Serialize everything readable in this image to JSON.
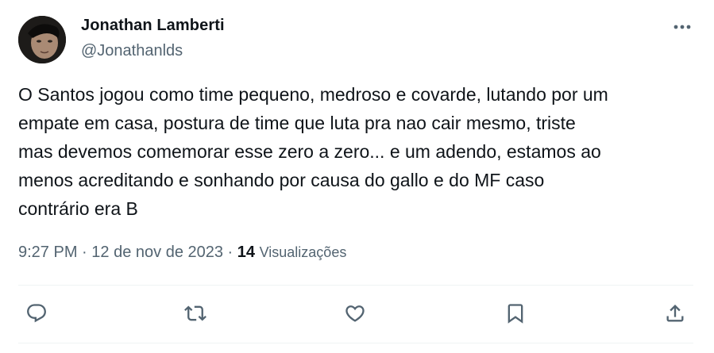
{
  "author": {
    "name": "Jonathan Lamberti",
    "handle": "@Jonathanlds"
  },
  "tweet": {
    "lines": [
      "O Santos jogou como time pequeno, medroso e covarde, lutando por um",
      "empate em casa, postura de time que luta pra nao cair mesmo, triste",
      "mas devemos comemorar esse zero a zero... e um adendo, estamos ao",
      "menos acreditando e sonhando por causa do gallo e do MF caso",
      "contrário era B"
    ]
  },
  "meta": {
    "time": "9:27 PM",
    "separator": "·",
    "date": "12 de nov de 2023",
    "views_count": "14",
    "views_label": "Visualizações"
  },
  "icons": {
    "more": "more-horizontal-icon",
    "reply": "reply-icon",
    "retweet": "retweet-icon",
    "like": "heart-icon",
    "bookmark": "bookmark-icon",
    "share": "share-icon"
  },
  "colors": {
    "text": "#0f1419",
    "secondary": "#536471",
    "divider": "#eff3f4"
  }
}
